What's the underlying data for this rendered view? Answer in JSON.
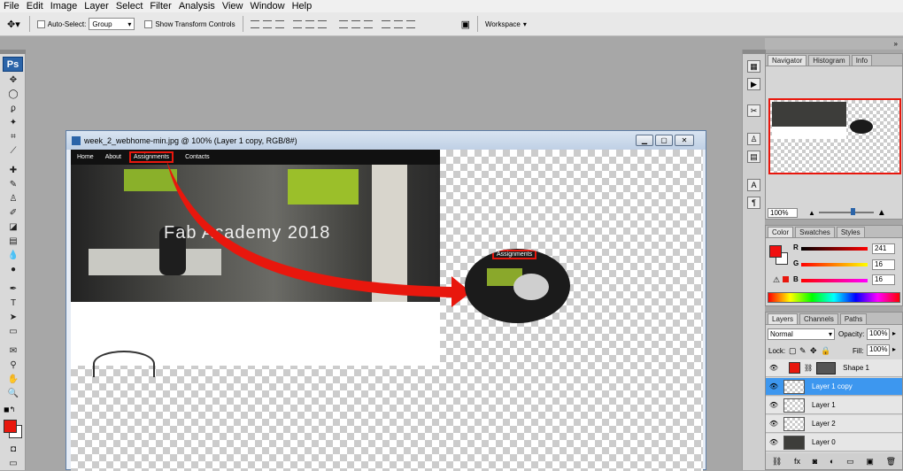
{
  "menu": [
    "File",
    "Edit",
    "Image",
    "Layer",
    "Select",
    "Filter",
    "Analysis",
    "View",
    "Window",
    "Help"
  ],
  "options": {
    "auto_select_label": "Auto-Select:",
    "auto_select_value": "Group",
    "show_transform_label": "Show Transform Controls",
    "workspace_label": "Workspace"
  },
  "tools": {
    "logo": "Ps"
  },
  "document": {
    "title": "week_2_webhome-min.jpg @ 100% (Layer 1 copy, RGB/8#)",
    "web_nav": [
      "Home",
      "About",
      "Assignments",
      "Contacts"
    ],
    "hero_title": "Fab Academy 2018",
    "oval_label": "Assignments"
  },
  "navigator": {
    "tabs": [
      "Navigator",
      "Histogram",
      "Info"
    ],
    "zoom": "100%"
  },
  "color": {
    "tabs": [
      "Color",
      "Swatches",
      "Styles"
    ],
    "r_label": "R",
    "g_label": "G",
    "b_label": "B",
    "r": "241",
    "g": "16",
    "b": "16",
    "foreground": "#f11010",
    "accent": "#e8170d"
  },
  "layers": {
    "tabs": [
      "Layers",
      "Channels",
      "Paths"
    ],
    "blend_mode": "Normal",
    "opacity_label": "Opacity:",
    "opacity": "100%",
    "lock_label": "Lock:",
    "fill_label": "Fill:",
    "fill": "100%",
    "items": [
      {
        "name": "Shape 1"
      },
      {
        "name": "Layer 1 copy"
      },
      {
        "name": "Layer 1"
      },
      {
        "name": "Layer 2"
      },
      {
        "name": "Layer 0"
      }
    ]
  }
}
